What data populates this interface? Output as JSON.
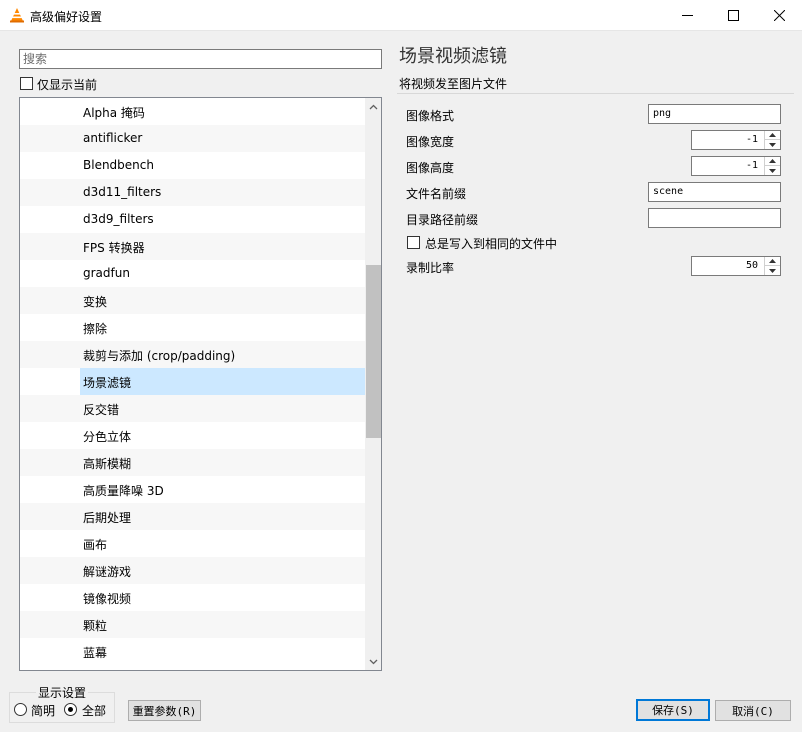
{
  "window": {
    "title": "高级偏好设置"
  },
  "search": {
    "placeholder": "搜索"
  },
  "show_current": {
    "label": "仅显示当前"
  },
  "tree": {
    "items": [
      {
        "label": "Alpha 掩码"
      },
      {
        "label": "antiflicker"
      },
      {
        "label": "Blendbench"
      },
      {
        "label": "d3d11_filters"
      },
      {
        "label": "d3d9_filters"
      },
      {
        "label": "FPS 转换器"
      },
      {
        "label": "gradfun"
      },
      {
        "label": "变换"
      },
      {
        "label": "擦除"
      },
      {
        "label": "裁剪与添加 (crop/padding)"
      },
      {
        "label": "场景滤镜",
        "selected": true
      },
      {
        "label": "反交错"
      },
      {
        "label": "分色立体"
      },
      {
        "label": "高斯模糊"
      },
      {
        "label": "高质量降噪 3D"
      },
      {
        "label": "后期处理"
      },
      {
        "label": "画布"
      },
      {
        "label": "解谜游戏"
      },
      {
        "label": "镜像视频"
      },
      {
        "label": "颗粒"
      },
      {
        "label": "蓝幕"
      }
    ]
  },
  "panel": {
    "title": "场景视频滤镜",
    "description": "将视频发至图片文件",
    "fields": {
      "format": {
        "label": "图像格式",
        "value": "png"
      },
      "width": {
        "label": "图像宽度",
        "value": "-1"
      },
      "height": {
        "label": "图像高度",
        "value": "-1"
      },
      "prefix": {
        "label": "文件名前缀",
        "value": "scene"
      },
      "path": {
        "label": "目录路径前缀",
        "value": ""
      },
      "replace": {
        "label": "总是写入到相同的文件中",
        "checked": false
      },
      "ratio": {
        "label": "录制比率",
        "value": "50"
      }
    }
  },
  "display_settings": {
    "title": "显示设置",
    "simple": "简明",
    "all": "全部",
    "selected": "all"
  },
  "buttons": {
    "reset": "重置参数(R)",
    "save": "保存(S)",
    "cancel": "取消(C)"
  },
  "colors": {
    "selection": "#cce8ff",
    "accent": "#0078d7",
    "vlc_orange": "#ff8800"
  }
}
